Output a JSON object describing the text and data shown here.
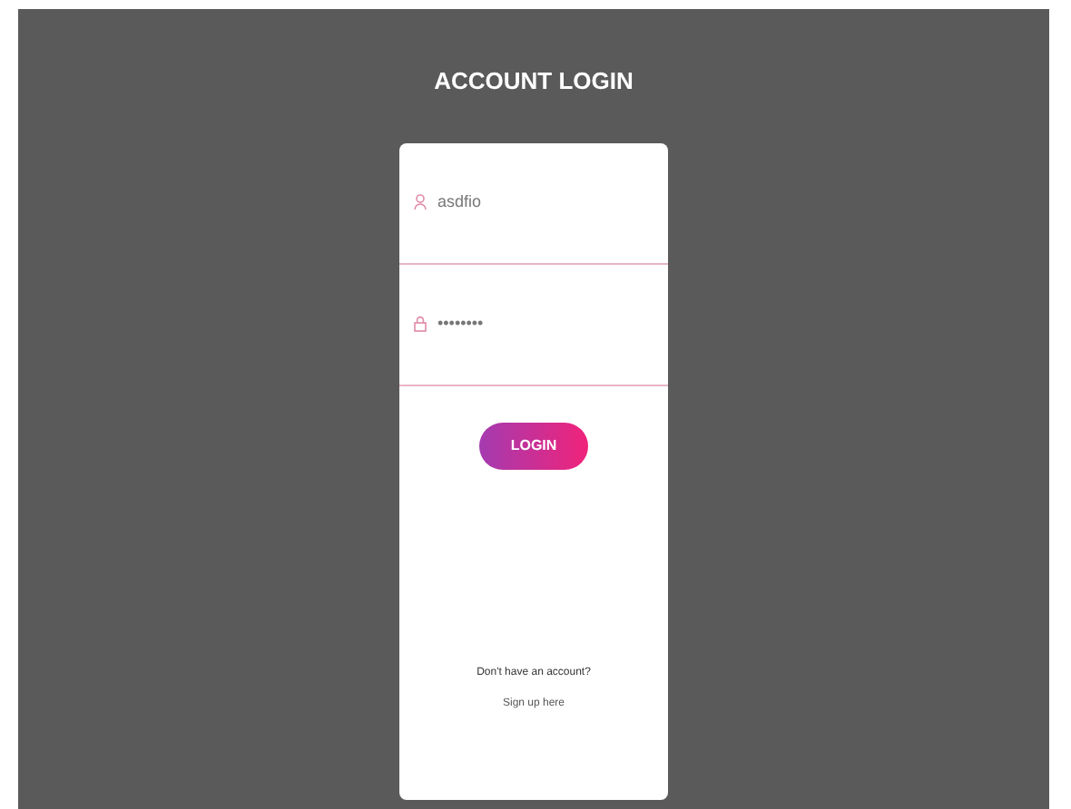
{
  "title": "ACCOUNT LOGIN",
  "fields": [
    {
      "kind": "text",
      "value": "asdfio"
    },
    {
      "kind": "password",
      "value": "••••••••"
    }
  ],
  "login_button": "LOGIN",
  "signup_prompt": "Don't have an account?",
  "signup_link": "Sign up here"
}
